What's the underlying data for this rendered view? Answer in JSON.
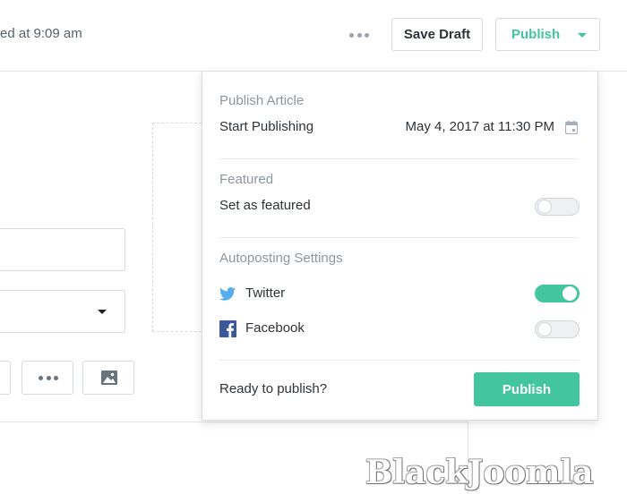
{
  "header": {
    "saved_status": "ed at 9:09 am",
    "save_draft_label": "Save Draft",
    "publish_label": "Publish"
  },
  "popover": {
    "publish_section_title": "Publish Article",
    "start_publishing_label": "Start Publishing",
    "start_publishing_value": "May 4, 2017 at 11:30 PM",
    "featured_section_title": "Featured",
    "set_featured_label": "Set as featured",
    "set_featured_on": false,
    "autoposting_section_title": "Autoposting Settings",
    "twitter_label": "Twitter",
    "twitter_on": true,
    "facebook_label": "Facebook",
    "facebook_on": false,
    "ready_text": "Ready to publish?",
    "publish_button_label": "Publish"
  },
  "colors": {
    "accent": "#43c6a0",
    "twitter": "#55acee",
    "facebook": "#3b5998"
  },
  "icons": {
    "more": "more-dots-icon",
    "calendar": "calendar-icon",
    "twitter": "twitter-icon",
    "facebook": "facebook-icon",
    "image": "image-icon"
  },
  "watermark": "BlackJoomla"
}
